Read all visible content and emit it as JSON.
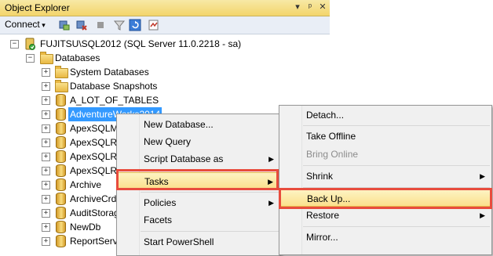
{
  "window": {
    "title": "Object Explorer",
    "pin_icon": "pin-icon",
    "close_icon": "close-icon",
    "dropdown_icon": "dropdown-icon"
  },
  "toolbar": {
    "connect_label": "Connect",
    "icons": [
      "connect-server-icon",
      "disconnect-icon",
      "stop-icon",
      "filter-icon",
      "refresh-icon",
      "activity-monitor-icon"
    ]
  },
  "tree": {
    "server": "FUJITSU\\SQL2012 (SQL Server 11.0.2218 - sa)",
    "databases_folder": "Databases",
    "items": [
      {
        "label": "System Databases",
        "icon": "folder"
      },
      {
        "label": "Database Snapshots",
        "icon": "folder"
      },
      {
        "label": "A_LOT_OF_TABLES",
        "icon": "database"
      },
      {
        "label": "AdventureWorks2014",
        "icon": "database",
        "selected": true
      },
      {
        "label": "ApexSQLM",
        "icon": "database"
      },
      {
        "label": "ApexSQLRe",
        "icon": "database"
      },
      {
        "label": "ApexSQLRe",
        "icon": "database"
      },
      {
        "label": "ApexSQLRe",
        "icon": "database"
      },
      {
        "label": "Archive",
        "icon": "database"
      },
      {
        "label": "ArchiveCrd",
        "icon": "database"
      },
      {
        "label": "AuditStorag",
        "icon": "database"
      },
      {
        "label": "NewDb",
        "icon": "database"
      },
      {
        "label": "ReportServ",
        "icon": "database"
      }
    ]
  },
  "context_menu": {
    "items": [
      "New Database...",
      "New Query",
      "Script Database as",
      "Tasks",
      "Policies",
      "Facets",
      "Start PowerShell"
    ]
  },
  "tasks_submenu": {
    "items": [
      "Detach...",
      "Take Offline",
      "Bring Online",
      "Shrink",
      "Back Up...",
      "Restore",
      "Mirror..."
    ]
  },
  "colors": {
    "selection": "#3399ff",
    "highlight_border": "#e84c3d",
    "titlebar": "#f3d56b"
  }
}
